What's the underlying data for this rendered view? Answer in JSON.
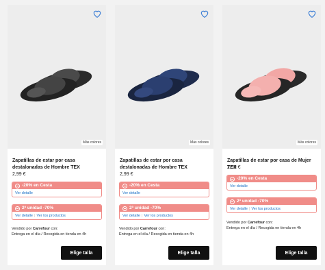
{
  "colors": {
    "promo": "#f08c88",
    "link": "#1a6fc6",
    "heart": "#3d7fd6",
    "cta": "#111111"
  },
  "products": [
    {
      "title": "Zapatillas de estar por casa destalonadas de Hombre TEX",
      "price": "2,99 €",
      "more_colors": "Más colores",
      "slipper_color": "dark-gray",
      "promos": [
        {
          "label": "-20% en Cesta",
          "links": [
            "Ver detalle"
          ]
        },
        {
          "label": "2ª unidad -70%",
          "links": [
            "Ver detalle",
            "Ver los productos"
          ]
        }
      ],
      "seller_prefix": "Vendido por ",
      "seller_name": "Carrefour",
      "seller_suffix": " con:",
      "delivery": "Entrega en el día /  Recogida en tienda en 4h",
      "cta": "Elige talla"
    },
    {
      "title": "Zapatillas de estar por casa destalonadas de Hombre TEX",
      "price": "2,99 €",
      "more_colors": "Más colores",
      "slipper_color": "navy",
      "promos": [
        {
          "label": "-20% en Cesta",
          "links": [
            "Ver detalle"
          ]
        },
        {
          "label": "2ª unidad -70%",
          "links": [
            "Ver detalle",
            "Ver los productos"
          ]
        }
      ],
      "seller_prefix": "Vendido por ",
      "seller_name": "Carrefour",
      "seller_suffix": " con:",
      "delivery": "Entrega en el día /  Recogida en tienda en 4h",
      "cta": "Elige talla"
    },
    {
      "title": "Zapatillas de estar por casa de Mujer TEX",
      "price": "2,99 €",
      "more_colors": "Más colores",
      "slipper_color": "pink",
      "promos": [
        {
          "label": "-20% en Cesta",
          "links": [
            "Ver detalle"
          ]
        },
        {
          "label": "2ª unidad -70%",
          "links": [
            "Ver detalle",
            "Ver los productos"
          ]
        }
      ],
      "seller_prefix": "Vendido por ",
      "seller_name": "Carrefour",
      "seller_suffix": " con:",
      "delivery": "Entrega en el día /  Recogida en tienda en 4h",
      "cta": "Elige talla"
    }
  ]
}
